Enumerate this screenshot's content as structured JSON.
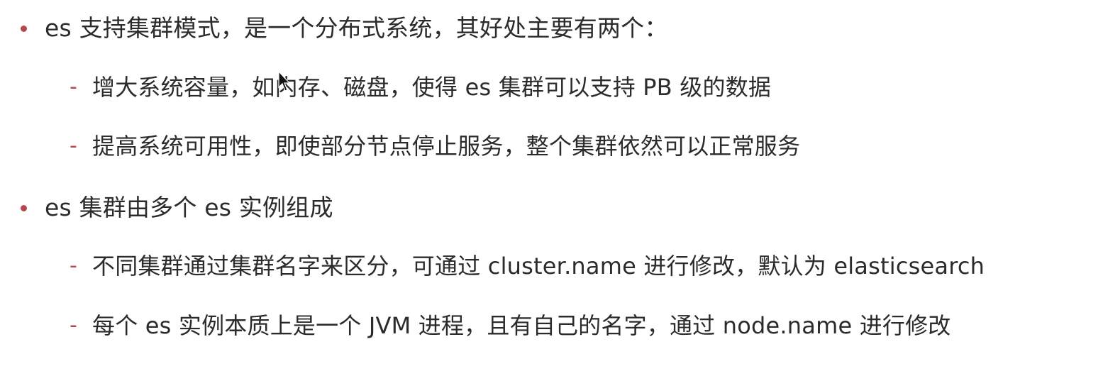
{
  "colors": {
    "accent": "#b5484f",
    "text": "#2b2b2b",
    "background": "#ffffff"
  },
  "bullets": [
    {
      "text": "es 支持集群模式，是一个分布式系统，其好处主要有两个：",
      "subitems": [
        {
          "marker": "-",
          "text": "增大系统容量，如内存、磁盘，使得 es 集群可以支持 PB 级的数据"
        },
        {
          "marker": "-",
          "text": "提高系统可用性，即使部分节点停止服务，整个集群依然可以正常服务"
        }
      ]
    },
    {
      "text": "es 集群由多个 es 实例组成",
      "subitems": [
        {
          "marker": "-",
          "text": "不同集群通过集群名字来区分，可通过 cluster.name 进行修改，默认为 elasticsearch"
        },
        {
          "marker": "-",
          "text": "每个 es 实例本质上是一个 JVM 进程，且有自己的名字，通过 node.name 进行修改"
        }
      ]
    }
  ],
  "icons": {
    "cursor": "mouse-pointer-icon"
  }
}
